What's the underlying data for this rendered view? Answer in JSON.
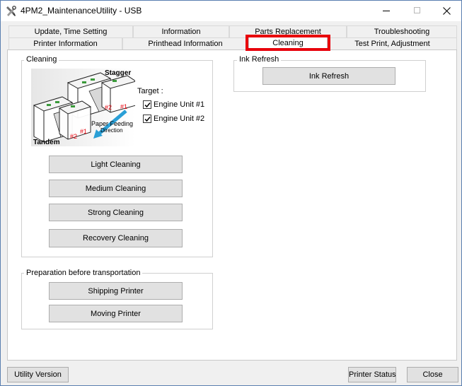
{
  "window": {
    "title": "4PM2_MaintenanceUtility - USB"
  },
  "tabs": {
    "row1": [
      {
        "label": "Update, Time Setting"
      },
      {
        "label": "Information"
      },
      {
        "label": "Parts Replacement"
      },
      {
        "label": "Troubleshooting"
      }
    ],
    "row2": [
      {
        "label": "Printer Information"
      },
      {
        "label": "Printhead Information"
      },
      {
        "label": "Cleaning"
      },
      {
        "label": "Test Print, Adjustment"
      }
    ],
    "active": "Cleaning"
  },
  "cleaning": {
    "group_title": "Cleaning",
    "illustration": {
      "stagger_label": "Stagger",
      "tandem_label": "Tandem",
      "unit_label_1": "#1",
      "unit_label_2": "#2",
      "feed_label_line1": "Paper Feeding",
      "feed_label_line2": "Direction"
    },
    "target_label": "Target :",
    "engine_unit_1": {
      "label": "Engine Unit #1",
      "checked": true
    },
    "engine_unit_2": {
      "label": "Engine Unit #2",
      "checked": true
    },
    "buttons": {
      "light": "Light Cleaning",
      "medium": "Medium Cleaning",
      "strong": "Strong Cleaning",
      "recovery": "Recovery Cleaning"
    }
  },
  "ink_refresh": {
    "group_title": "Ink Refresh",
    "button": "Ink Refresh"
  },
  "transport": {
    "group_title": "Preparation before transportation",
    "shipping": "Shipping Printer",
    "moving": "Moving Printer"
  },
  "footer": {
    "utility_version": "Utility Version",
    "printer_status": "Printer Status",
    "close": "Close"
  },
  "colors": {
    "highlight": "#e8000b",
    "arrow": "#2a9fd6",
    "unit_label": "#e8000b"
  }
}
